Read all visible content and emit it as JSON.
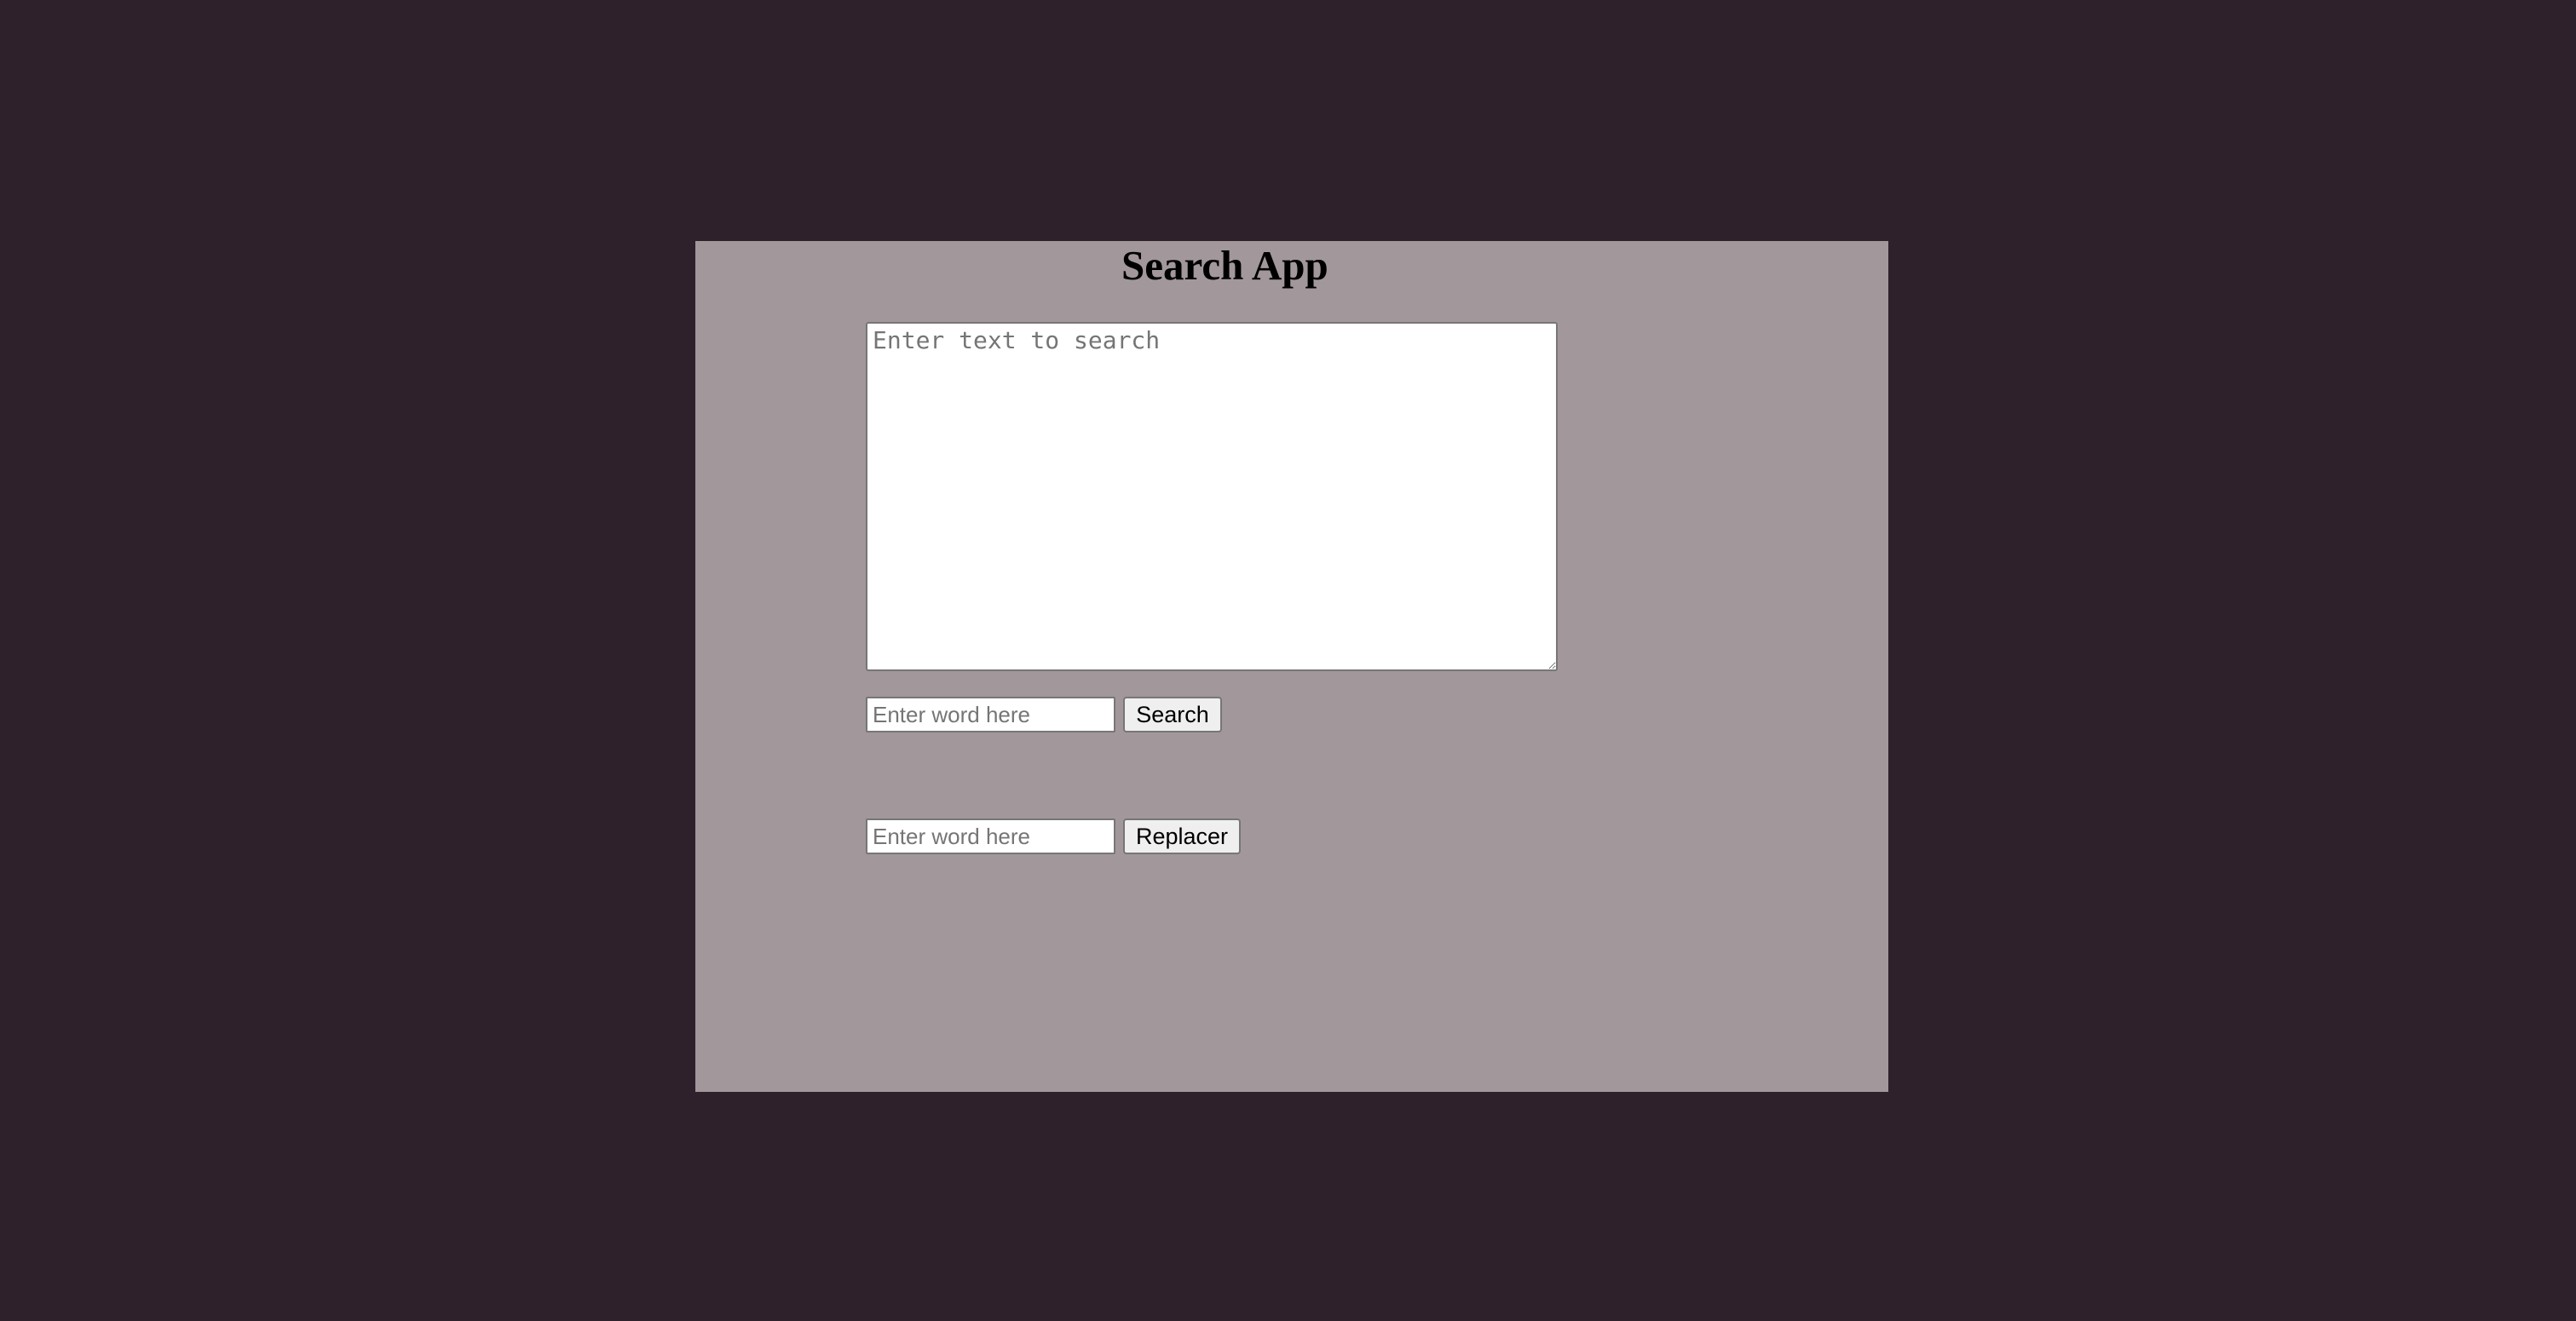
{
  "app": {
    "title": "Search App"
  },
  "search_text": {
    "placeholder": "Enter text to search",
    "value": ""
  },
  "search_row": {
    "input_placeholder": "Enter word here",
    "button_label": "Search"
  },
  "replace_row": {
    "input_placeholder": "Enter word here",
    "button_label": "Replacer"
  },
  "colors": {
    "page_background": "#2e212b",
    "panel_background": "#a2979a"
  }
}
